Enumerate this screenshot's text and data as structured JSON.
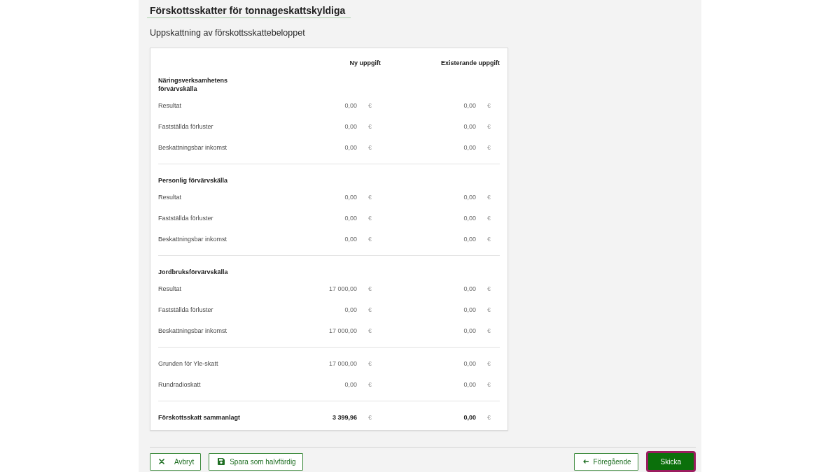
{
  "page": {
    "title": "Förskottsskatter för tonnageskattskyldiga",
    "subtitle": "Uppskattning av förskottsskattebeloppet"
  },
  "estimate": {
    "columns": [
      "Ny uppgift",
      "Existerande uppgift"
    ],
    "sections": [
      {
        "heading": "Näringsverksamhetens förvärvskälla",
        "rows": [
          {
            "label": "Resultat",
            "new_value": "0,00",
            "new_unit": "€",
            "existing_value": "0,00",
            "existing_unit": "€"
          },
          {
            "label": "Fastställda förluster",
            "new_value": "0,00",
            "new_unit": "€",
            "existing_value": "0,00",
            "existing_unit": "€"
          },
          {
            "label": "Beskattningsbar inkomst",
            "new_value": "0,00",
            "new_unit": "€",
            "existing_value": "0,00",
            "existing_unit": "€"
          }
        ]
      },
      {
        "heading": "Personlig förvärvskälla",
        "rows": [
          {
            "label": "Resultat",
            "new_value": "0,00",
            "new_unit": "€",
            "existing_value": "0,00",
            "existing_unit": "€"
          },
          {
            "label": "Fastställda förluster",
            "new_value": "0,00",
            "new_unit": "€",
            "existing_value": "0,00",
            "existing_unit": "€"
          },
          {
            "label": "Beskattningsbar inkomst",
            "new_value": "0,00",
            "new_unit": "€",
            "existing_value": "0,00",
            "existing_unit": "€"
          }
        ]
      },
      {
        "heading": "Jordbruksförvärvskälla",
        "rows": [
          {
            "label": "Resultat",
            "new_value": "17 000,00",
            "new_unit": "€",
            "existing_value": "0,00",
            "existing_unit": "€"
          },
          {
            "label": "Fastställda förluster",
            "new_value": "0,00",
            "new_unit": "€",
            "existing_value": "0,00",
            "existing_unit": "€"
          },
          {
            "label": "Beskattningsbar inkomst",
            "new_value": "17 000,00",
            "new_unit": "€",
            "existing_value": "0,00",
            "existing_unit": "€"
          }
        ]
      },
      {
        "rows": [
          {
            "label": "Grunden för Yle-skatt",
            "new_value": "17 000,00",
            "new_unit": "€",
            "existing_value": "0,00",
            "existing_unit": "€"
          },
          {
            "label": "Rundradioskatt",
            "new_value": "0,00",
            "new_unit": "€",
            "existing_value": "0,00",
            "existing_unit": "€"
          }
        ]
      }
    ],
    "total": {
      "label": "Förskottsskatt sammanlagt",
      "new_value": "3 399,96",
      "new_unit": "€",
      "existing_value": "0,00",
      "existing_unit": "€"
    }
  },
  "footer": {
    "left_buttons": [
      {
        "label": "Avbryt",
        "kind": "cancel",
        "focused": false
      },
      {
        "label": "Spara som halvfärdig",
        "kind": "save",
        "focused": false
      }
    ],
    "right_buttons": [
      {
        "label": "Föregående",
        "kind": "back",
        "focused": false
      },
      {
        "label": "Skicka",
        "kind": "submit",
        "focused": true
      }
    ]
  }
}
